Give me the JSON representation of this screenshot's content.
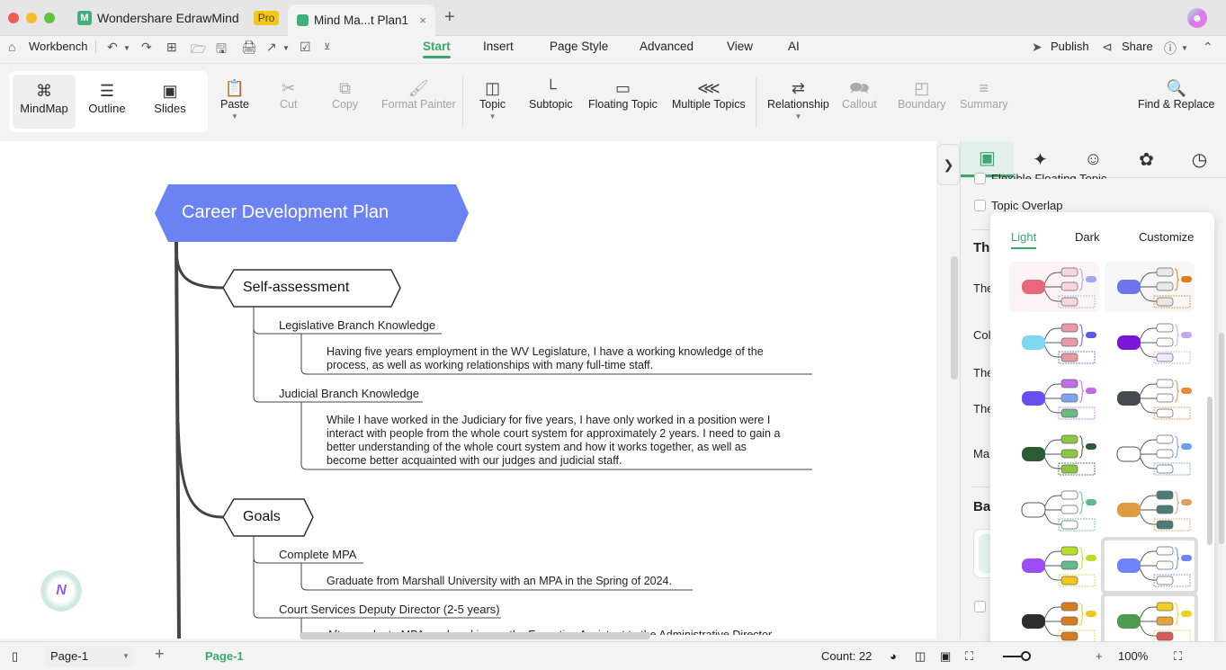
{
  "window": {
    "app_tab": "Wondershare EdrawMind",
    "pro_badge": "Pro",
    "doc_tab": "Mind Ma...t Plan1",
    "close_glyph": "×",
    "new_tab_glyph": "+"
  },
  "menubar": {
    "workbench": "Workbench",
    "tabs": [
      "Start",
      "Insert",
      "Page Style",
      "Advanced",
      "View",
      "AI"
    ],
    "active_tab": "Start",
    "publish": "Publish",
    "share": "Share"
  },
  "toolbar": {
    "views": [
      "MindMap",
      "Outline",
      "Slides"
    ],
    "active_view": "MindMap",
    "paste": "Paste",
    "cut": "Cut",
    "copy": "Copy",
    "format_painter": "Format Painter",
    "topic": "Topic",
    "subtopic": "Subtopic",
    "floating_topic": "Floating Topic",
    "multiple_topics": "Multiple Topics",
    "relationship": "Relationship",
    "callout": "Callout",
    "boundary": "Boundary",
    "summary": "Summary",
    "find_replace": "Find & Replace"
  },
  "mindmap": {
    "root": "Career Development Plan",
    "root_color": "#6b83f2",
    "branches": [
      {
        "label": "Self-assessment",
        "children": [
          {
            "label": "Legislative Branch Knowledge",
            "note": [
              "Having five years employment in the WV Legislature, I have a working knowledge of the",
              "process, as well as working relationships with many full-time staff."
            ]
          },
          {
            "label": "Judicial Branch Knowledge",
            "note": [
              "While I have worked in the Judiciary for five years, I have only worked in a position were I",
              "interact with people from the whole court system for approximately 2 years.  I need to gain a",
              "better understanding of the whole court system and how it works together, as well as",
              "become better acquainted with our judges and judicial staff."
            ]
          }
        ]
      },
      {
        "label": "Goals",
        "children": [
          {
            "label": "Complete MPA",
            "note": [
              "Graduate from Marshall University with an MPA in the Spring of 2024."
            ]
          },
          {
            "label": "Court Services Deputy Director (2-5 years)",
            "note": [
              "After graduate MPA, and working as the Executive Assistant to the Administrative Director..."
            ]
          }
        ]
      }
    ]
  },
  "right_panel": {
    "tabs": [
      "page-format",
      "ai-sparkle",
      "icon-mark",
      "theme-style",
      "history"
    ],
    "flexible_floating_topic": "Flexible Floating Topic",
    "topic_overlap": "Topic Overlap",
    "theme_heading_partial": "The",
    "rows_partial": [
      "The",
      "Col",
      "The",
      "The",
      "Ma"
    ],
    "background_heading_partial": "Bac"
  },
  "theme_popup": {
    "tabs": [
      "Light",
      "Dark",
      "Customize"
    ],
    "active_tab": "Light",
    "themes": [
      {
        "center": "#e8677a",
        "a": "#f7d7dc",
        "b": "#f7d7dc",
        "c": "#f7d7dc",
        "accent": "#9da8f5",
        "bg": "#fbf3f4"
      },
      {
        "center": "#6b74ea",
        "a": "#e8e8e8",
        "b": "#e8e8e8",
        "c": "#e8e8e8",
        "accent": "#e87a18",
        "bg": "#f7f7f7"
      },
      {
        "center": "#7fd8f2",
        "a": "#e89aa0",
        "b": "#e89aa0",
        "c": "#e89aa0",
        "accent": "#5b57e8",
        "bg": "#ffffff"
      },
      {
        "center": "#7a16d8",
        "a": "#ffffff",
        "b": "#ffffff",
        "c": "#f3e8fd",
        "accent": "#c6a6f0",
        "bg": "#ffffff"
      },
      {
        "center": "#6a4ff0",
        "a": "#c26af0",
        "b": "#7fa3f4",
        "c": "#6bb982",
        "accent": "#c26af0",
        "bg": "#ffffff"
      },
      {
        "center": "#464b52",
        "a": "#ffffff",
        "b": "#ffffff",
        "c": "#ffffff",
        "accent": "#e88a3c",
        "bg": "#ffffff"
      },
      {
        "center": "#2c5a34",
        "a": "#8cc63e",
        "b": "#8cc63e",
        "c": "#8cc63e",
        "accent": "#2c5a34",
        "bg": "#ffffff"
      },
      {
        "center": "#ffffff",
        "a": "#ffffff",
        "b": "#ffffff",
        "c": "#ffffff",
        "accent": "#6aa0f2",
        "bg": "#ffffff"
      },
      {
        "center": "#ffffff",
        "a": "#ffffff",
        "b": "#ffffff",
        "c": "#ffffff",
        "accent": "#5dbb8a",
        "bg": "#ffffff"
      },
      {
        "center": "#e09a44",
        "a": "#4a7d76",
        "b": "#4a7d76",
        "c": "#4a7d76",
        "accent": "#e0a060",
        "bg": "#ffffff"
      },
      {
        "center": "#9c4df5",
        "a": "#b8e023",
        "b": "#62ba8e",
        "c": "#f0c81a",
        "accent": "#b8e023",
        "bg": "#ffffff"
      },
      {
        "center": "#6e84f6",
        "a": "#ffffff",
        "b": "#ffffff",
        "c": "#ffffff",
        "accent": "#6e84f6",
        "bg": "#ffffff"
      },
      {
        "center": "#2e2e2e",
        "a": "#d97b1e",
        "b": "#d97b1e",
        "c": "#d97b1e",
        "accent": "#f0c81a",
        "bg": "#ffffff"
      },
      {
        "center": "#4e9a4e",
        "a": "#f0d020",
        "b": "#e8a23c",
        "c": "#d85a5a",
        "accent": "#f0d020",
        "bg": "#ffffff"
      }
    ],
    "selected_indices": [
      11,
      13
    ]
  },
  "statusbar": {
    "page_select": "Page-1",
    "page_tab": "Page-1",
    "count": "Count: 22",
    "zoom": "100%"
  },
  "colors": {
    "accent": "#3aa86d",
    "root": "#6b83f2"
  }
}
